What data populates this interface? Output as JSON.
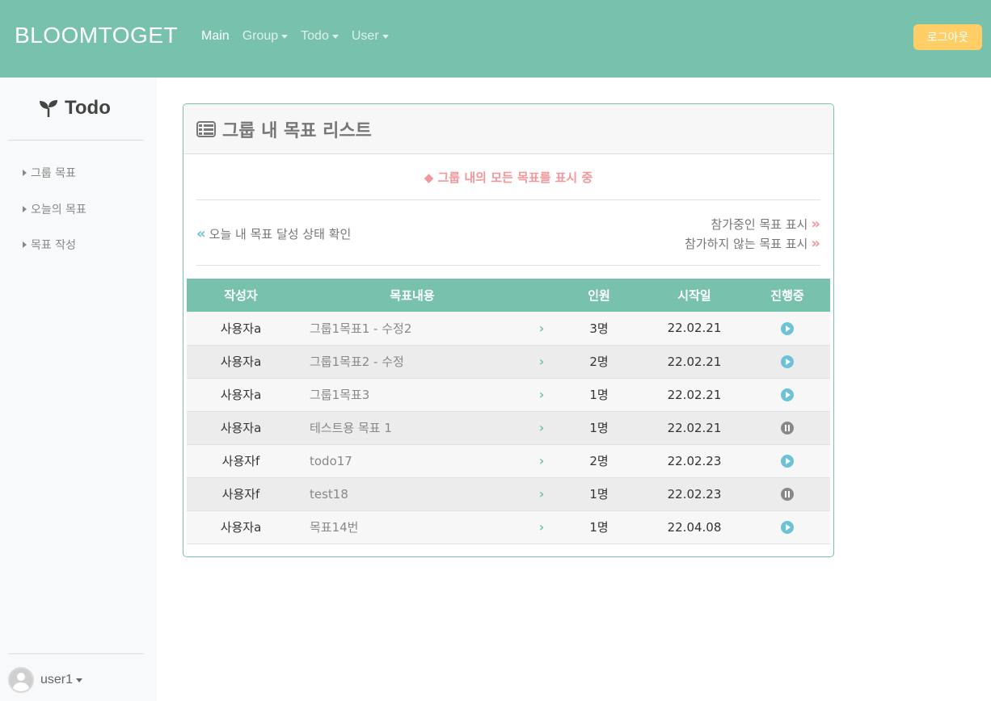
{
  "navbar": {
    "brand": "BLOOMTOGET",
    "links": [
      {
        "label": "Main",
        "active": true,
        "dropdown": false
      },
      {
        "label": "Group",
        "active": false,
        "dropdown": true
      },
      {
        "label": "Todo",
        "active": false,
        "dropdown": true
      },
      {
        "label": "User",
        "active": false,
        "dropdown": true
      }
    ],
    "logout_label": "로그아웃"
  },
  "sidebar": {
    "title": "Todo",
    "items": [
      {
        "label": "그룹 목표"
      },
      {
        "label": "오늘의 목표"
      },
      {
        "label": "목표 작성"
      }
    ],
    "user": "user1"
  },
  "card": {
    "title": "그룹 내 목표 리스트",
    "notice": "◆ 그룹 내의 모든 목표를 표시 중",
    "link_left": "오늘 내 목표 달성 상태 확인",
    "link_right_1": "참가중인 목표 표시",
    "link_right_2": "참가하지 않는 목표 표시"
  },
  "table": {
    "headers": [
      "작성자",
      "목표내용",
      "",
      "인원",
      "시작일",
      "진행중"
    ],
    "rows": [
      {
        "author": "사용자a",
        "content": "그룹1목표1 - 수정2",
        "members": "3명",
        "start": "22.02.21",
        "status": "play"
      },
      {
        "author": "사용자a",
        "content": "그룹1목표2 - 수정",
        "members": "2명",
        "start": "22.02.21",
        "status": "play"
      },
      {
        "author": "사용자a",
        "content": "그룹1목표3",
        "members": "1명",
        "start": "22.02.21",
        "status": "play"
      },
      {
        "author": "사용자a",
        "content": "테스트용 목표 1",
        "members": "1명",
        "start": "22.02.21",
        "status": "pause"
      },
      {
        "author": "사용자f",
        "content": "todo17",
        "members": "2명",
        "start": "22.02.23",
        "status": "play"
      },
      {
        "author": "사용자f",
        "content": "test18",
        "members": "1명",
        "start": "22.02.23",
        "status": "pause"
      },
      {
        "author": "사용자a",
        "content": "목표14번",
        "members": "1명",
        "start": "22.04.08",
        "status": "play"
      }
    ]
  },
  "colors": {
    "primary": "#78c2ad",
    "warning": "#ffce67",
    "accent": "#f3969a",
    "info": "#6cc3d5"
  }
}
